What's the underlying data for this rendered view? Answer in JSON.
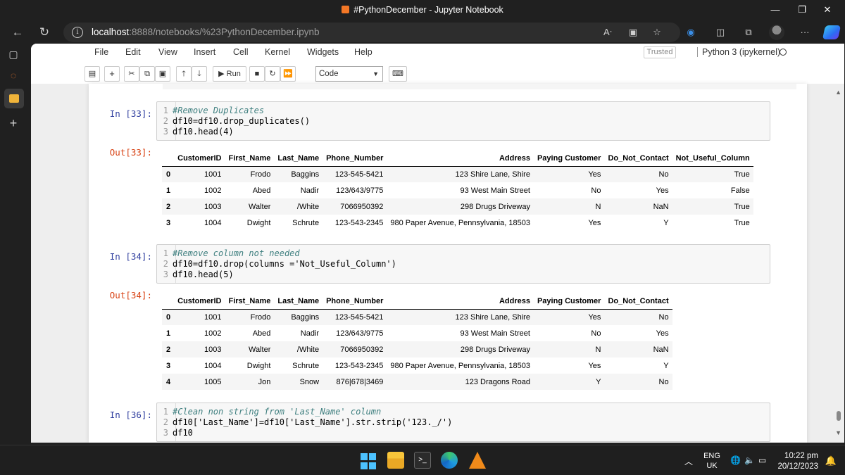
{
  "window": {
    "title": "#PythonDecember - Jupyter Notebook",
    "minimize": "—",
    "restore": "❐",
    "close": "✕"
  },
  "browser": {
    "url_host": "localhost",
    "url_path": ":8888/notebooks/%23PythonDecember.ipynb",
    "more": "···"
  },
  "jupyter": {
    "menu": [
      "File",
      "Edit",
      "View",
      "Insert",
      "Cell",
      "Kernel",
      "Widgets",
      "Help"
    ],
    "trusted": "Trusted",
    "kernel": "Python 3 (ipykernel)",
    "toolbar": {
      "run_label": "Run",
      "cell_type": "Code"
    }
  },
  "cells": {
    "c33": {
      "in_prompt": "In [33]:",
      "out_prompt": "Out[33]:",
      "code": [
        "#Remove Duplicates",
        "df10=df10.drop_duplicates()",
        "df10.head(4)"
      ],
      "table": {
        "columns": [
          "",
          "CustomerID",
          "First_Name",
          "Last_Name",
          "Phone_Number",
          "Address",
          "Paying Customer",
          "Do_Not_Contact",
          "Not_Useful_Column"
        ],
        "rows": [
          [
            "0",
            "1001",
            "Frodo",
            "Baggins",
            "123-545-5421",
            "123 Shire Lane, Shire",
            "Yes",
            "No",
            "True"
          ],
          [
            "1",
            "1002",
            "Abed",
            "Nadir",
            "123/643/9775",
            "93 West Main Street",
            "No",
            "Yes",
            "False"
          ],
          [
            "2",
            "1003",
            "Walter",
            "/White",
            "7066950392",
            "298 Drugs Driveway",
            "N",
            "NaN",
            "True"
          ],
          [
            "3",
            "1004",
            "Dwight",
            "Schrute",
            "123-543-2345",
            "980 Paper Avenue, Pennsylvania, 18503",
            "Yes",
            "Y",
            "True"
          ]
        ]
      }
    },
    "c34": {
      "in_prompt": "In [34]:",
      "out_prompt": "Out[34]:",
      "code": [
        "#Remove column not needed",
        "df10=df10.drop(columns ='Not_Useful_Column')",
        "df10.head(5)"
      ],
      "table": {
        "columns": [
          "",
          "CustomerID",
          "First_Name",
          "Last_Name",
          "Phone_Number",
          "Address",
          "Paying Customer",
          "Do_Not_Contact"
        ],
        "rows": [
          [
            "0",
            "1001",
            "Frodo",
            "Baggins",
            "123-545-5421",
            "123 Shire Lane, Shire",
            "Yes",
            "No"
          ],
          [
            "1",
            "1002",
            "Abed",
            "Nadir",
            "123/643/9775",
            "93 West Main Street",
            "No",
            "Yes"
          ],
          [
            "2",
            "1003",
            "Walter",
            "/White",
            "7066950392",
            "298 Drugs Driveway",
            "N",
            "NaN"
          ],
          [
            "3",
            "1004",
            "Dwight",
            "Schrute",
            "123-543-2345",
            "980 Paper Avenue, Pennsylvania, 18503",
            "Yes",
            "Y"
          ],
          [
            "4",
            "1005",
            "Jon",
            "Snow",
            "876|678|3469",
            "123 Dragons Road",
            "Y",
            "No"
          ]
        ]
      }
    },
    "c36": {
      "in_prompt": "In [36]:",
      "code": [
        "#Clean non string from 'Last_Name' column",
        "df10['Last_Name']=df10['Last_Name'].str.strip('123._/')",
        "df10"
      ]
    }
  },
  "taskbar": {
    "lang": "ENG",
    "region": "UK",
    "time": "10:22 pm",
    "date": "20/12/2023"
  }
}
